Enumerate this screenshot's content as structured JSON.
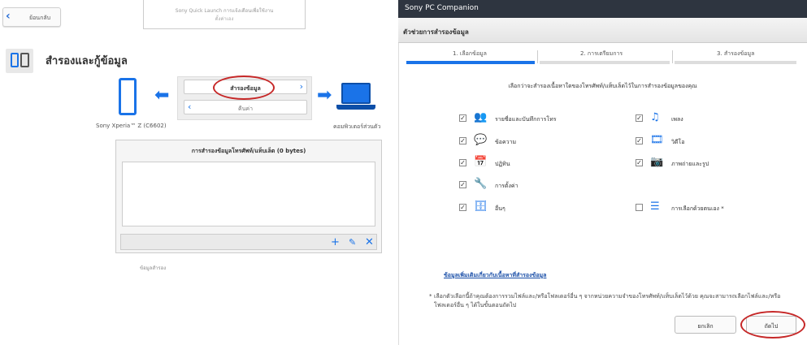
{
  "left": {
    "back_label": "ย้อนกลับ",
    "top_box_line1": "Sony Quick Launch การแจ้งเตือนเพื่อใช้งาน",
    "top_box_line2": "ตั้งค่าเอง",
    "section_title": "สำรองและกู้ข้อมูล",
    "backup_button": "สำรองข้อมูล",
    "restore_button": "คืนค่า",
    "phone_label": "Sony Xperia™ Z (C6602)",
    "computer_label": "คอมพิวเตอร์ส่วนตัว",
    "list_header": "การสำรองข้อมูลโทรศัพท์/แท็บเล็ต (0 bytes)",
    "cutoff_text": "ข้อมูลสำรอง"
  },
  "right": {
    "window_title": "Sony PC Companion",
    "wizard_header": "ตัวช่วยการสำรองข้อมูล",
    "steps": [
      {
        "label": "1. เลือกข้อมูล",
        "active": true
      },
      {
        "label": "2. การเตรียมการ",
        "active": false
      },
      {
        "label": "3. สำรองข้อมูล",
        "active": false
      }
    ],
    "instruction": "เลือกว่าจะสำรองเนื้อหาใดของโทรศัพท์/แท็บเล็ตไว้ในการสำรองข้อมูลของคุณ",
    "items_left": [
      {
        "label": "รายชื่อและบันทึกการโทร",
        "checked": true,
        "icon": "contacts-icon",
        "glyph": "👥"
      },
      {
        "label": "ข้อความ",
        "checked": true,
        "icon": "message-icon",
        "glyph": "💬"
      },
      {
        "label": "ปฏิทิน",
        "checked": true,
        "icon": "calendar-icon",
        "glyph": "📅"
      },
      {
        "label": "การตั้งค่า",
        "checked": true,
        "icon": "wrench-icon",
        "glyph": "🔧"
      },
      {
        "label": "อื่นๆ",
        "checked": true,
        "icon": "database-icon",
        "glyph": "🗄"
      }
    ],
    "items_right": [
      {
        "label": "เพลง",
        "checked": true,
        "icon": "music-icon",
        "glyph": "♫"
      },
      {
        "label": "วิดีโอ",
        "checked": true,
        "icon": "film-icon",
        "glyph": "🎞"
      },
      {
        "label": "ภาพถ่ายและรูป",
        "checked": true,
        "icon": "camera-icon",
        "glyph": "📷"
      },
      {
        "label": "การเลือกด้วยตนเอง *",
        "checked": false,
        "icon": "list-icon",
        "glyph": "☰"
      }
    ],
    "more_link": "ข้อมูลเพิ่มเติมเกี่ยวกับเนื้อหาที่สำรองข้อมูล",
    "footnote_star": "*",
    "footnote": "เลือกตัวเลือกนี้ถ้าคุณต้องการรวมไฟล์และ/หรือโฟลเดอร์อื่น ๆ จากหน่วยความจำของโทรศัพท์/แท็บเล็ตไว้ด้วย คุณจะสามารถเลือกไฟล์และ/หรือโฟลเดอร์อื่น ๆ ได้ในขั้นตอนถัดไป",
    "cancel_button": "ยกเลิก",
    "next_button": "ถัดไป"
  },
  "colors": {
    "accent": "#1a73e8",
    "highlight": "#c62828",
    "titlebar": "#2e3540"
  }
}
